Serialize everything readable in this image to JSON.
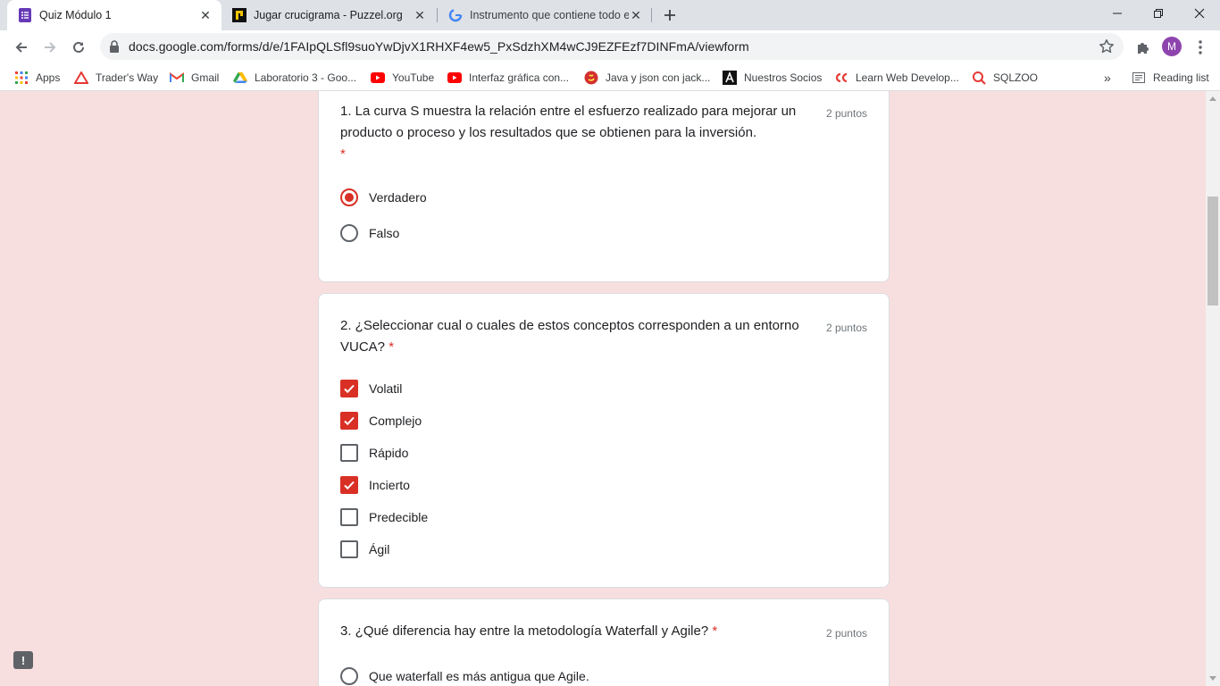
{
  "browser": {
    "tabs": [
      {
        "title": "Quiz Módulo 1",
        "active": true,
        "icon": "google-forms-icon"
      },
      {
        "title": "Jugar crucigrama - Puzzel.org",
        "active": false,
        "icon": "puzzel-icon"
      },
      {
        "title": "Instrumento que contiene todo e",
        "active": false,
        "icon": "google-icon"
      }
    ],
    "url": "docs.google.com/forms/d/e/1FAIpQLSfl9suoYwDjvX1RHXF4ew5_PxSdzhXM4wCJ9EZFEzf7DINFmA/viewform",
    "avatar_letter": "M",
    "bookmarks": [
      {
        "label": "Apps",
        "icon": "apps-grid-icon"
      },
      {
        "label": "Trader's Way",
        "icon": "traders-way-icon"
      },
      {
        "label": "Gmail",
        "icon": "gmail-icon"
      },
      {
        "label": "Laboratorio 3 - Goo...",
        "icon": "google-drive-icon"
      },
      {
        "label": "YouTube",
        "icon": "youtube-icon"
      },
      {
        "label": "Interfaz gráfica con...",
        "icon": "youtube-icon"
      },
      {
        "label": "Java y json con jack...",
        "icon": "java-icon"
      },
      {
        "label": "Nuestros Socios",
        "icon": "a-logo-icon"
      },
      {
        "label": "Learn Web Develop...",
        "icon": "codecademy-icon"
      },
      {
        "label": "SQLZOO",
        "icon": "sqlzoo-icon"
      }
    ],
    "more_bookmarks": "»",
    "reading_list": "Reading list"
  },
  "form": {
    "q1": {
      "title": "1. La curva S muestra la relación entre el esfuerzo realizado para mejorar un producto o proceso y los resultados que se obtienen para la inversión.",
      "required_mark": "*",
      "points": "2 puntos",
      "options": [
        "Verdadero",
        "Falso"
      ],
      "selected": "Verdadero"
    },
    "q2": {
      "title": "2. ¿Seleccionar cual o cuales de estos conceptos corresponden a un entorno VUCA?",
      "required_mark": "*",
      "points": "2 puntos",
      "options": [
        "Volatil",
        "Complejo",
        "Rápido",
        "Incierto",
        "Predecible",
        "Ágil"
      ],
      "checked": [
        "Volatil",
        "Complejo",
        "Incierto"
      ]
    },
    "q3": {
      "title": "3. ¿Qué diferencia hay entre la metodología Waterfall y Agile?",
      "required_mark": "*",
      "points": "2 puntos",
      "options": [
        "Que waterfall es más antigua que Agile."
      ]
    },
    "feedback_icon": "!"
  },
  "colors": {
    "page_background": "#f8dfdf",
    "accent": "#d93025",
    "forms_purple": "#673ab7"
  }
}
